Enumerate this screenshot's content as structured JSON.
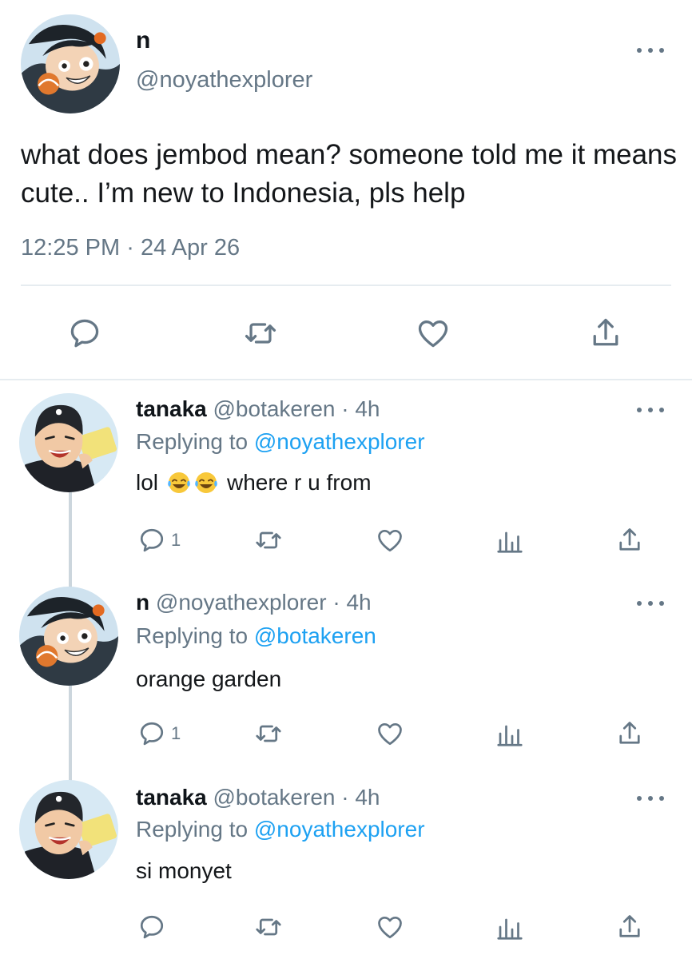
{
  "main_tweet": {
    "display_name": "n",
    "handle": "@noyathexplorer",
    "text": "what does jembod mean? someone told me it means cute.. I’m new to Indonesia, pls help",
    "time": "12:25 PM",
    "separator": "·",
    "date": "24 Apr 26",
    "actions": [
      "reply-icon",
      "retweet-icon",
      "like-icon",
      "share-icon"
    ]
  },
  "replies": [
    {
      "display_name": "tanaka",
      "handle": "@botakeren",
      "dot": "·",
      "age": "4h",
      "replying_prefix": "Replying to ",
      "replying_to": "@noyathexplorer",
      "text_before": "lol",
      "emoji": "face-with-tears-of-joy x2",
      "text_after": "where r u from",
      "reply_count": "1"
    },
    {
      "display_name": "n",
      "handle": "@noyathexplorer",
      "dot": "·",
      "age": "4h",
      "replying_prefix": "Replying to ",
      "replying_to": "@botakeren",
      "text": "orange garden",
      "reply_count": "1"
    },
    {
      "display_name": "tanaka",
      "handle": "@botakeren",
      "dot": "·",
      "age": "4h",
      "replying_prefix": "Replying to ",
      "replying_to": "@noyathexplorer",
      "text": "si monyet",
      "reply_count": ""
    }
  ],
  "colors": {
    "accent": "#1da1f2",
    "secondary_text": "#657786",
    "divider": "#e6ecf0",
    "thread_line": "#ccd6dd"
  }
}
